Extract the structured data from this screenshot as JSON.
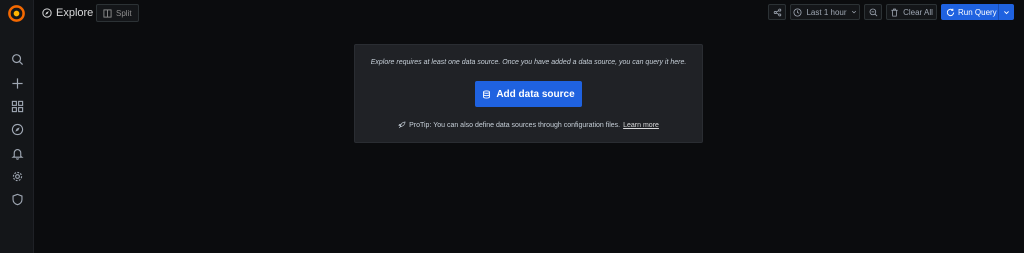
{
  "colors": {
    "background": "#0b0c0e",
    "sidebar": "#141619",
    "panel": "#202226",
    "primary": "#1f62e0",
    "logo": "#f46800"
  },
  "sidebar": {
    "items": [
      {
        "icon": "search-icon"
      },
      {
        "icon": "plus-icon"
      },
      {
        "icon": "dashboards-icon"
      },
      {
        "icon": "compass-icon"
      },
      {
        "icon": "bell-icon"
      },
      {
        "icon": "gear-icon"
      },
      {
        "icon": "shield-icon"
      }
    ]
  },
  "header": {
    "title": "Explore",
    "split_label": "Split"
  },
  "toolbar": {
    "time_range": "Last 1 hour",
    "clear_all": "Clear All",
    "run_query": "Run Query"
  },
  "empty_state": {
    "message": "Explore requires at least one data source. Once you have added a data source, you can query it here.",
    "add_button": "Add data source",
    "protip": "ProTip: You can also define data sources through configuration files.",
    "learn_more": "Learn more"
  }
}
